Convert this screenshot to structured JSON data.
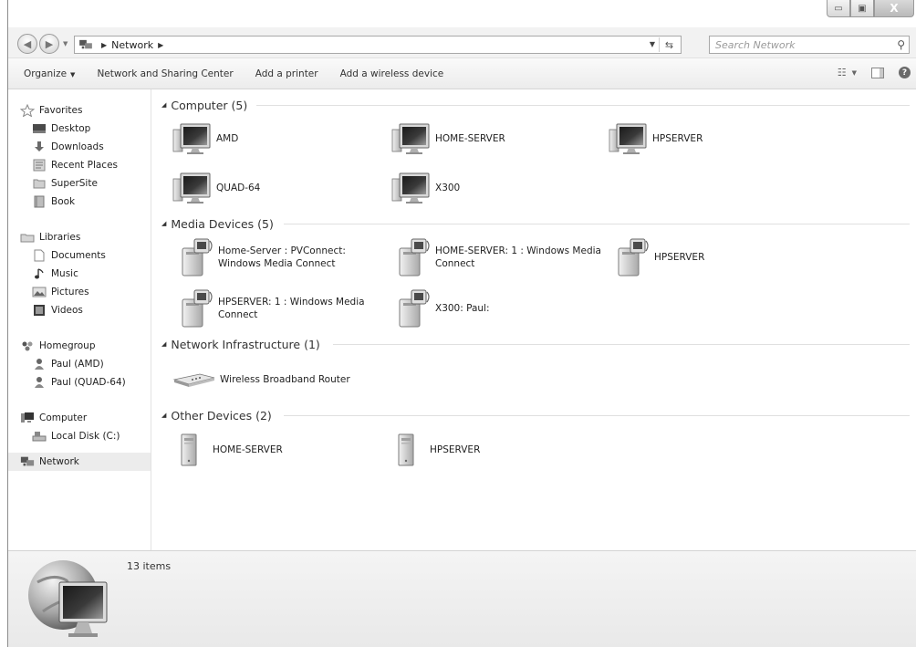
{
  "window": {
    "caption": {
      "minimize": "▭",
      "maximize": "▣",
      "close": "X"
    }
  },
  "address": {
    "crumb": "Network",
    "search_placeholder": "Search Network"
  },
  "toolbar": {
    "organize": "Organize",
    "network_center": "Network and Sharing Center",
    "add_printer": "Add a printer",
    "add_wireless": "Add a wireless device"
  },
  "sidebar": {
    "favorites": {
      "label": "Favorites",
      "items": [
        "Desktop",
        "Downloads",
        "Recent Places",
        "SuperSite",
        "Book"
      ]
    },
    "libraries": {
      "label": "Libraries",
      "items": [
        "Documents",
        "Music",
        "Pictures",
        "Videos"
      ]
    },
    "homegroup": {
      "label": "Homegroup",
      "items": [
        "Paul (AMD)",
        "Paul (QUAD-64)"
      ]
    },
    "computer": {
      "label": "Computer",
      "items": [
        "Local Disk (C:)"
      ]
    },
    "network": {
      "label": "Network"
    }
  },
  "groups": {
    "computer": {
      "header": "Computer (5)",
      "items": [
        "AMD",
        "HOME-SERVER",
        "HPSERVER",
        "QUAD-64",
        "X300"
      ]
    },
    "media": {
      "header": "Media Devices (5)",
      "items": [
        {
          "line1": "Home-Server : PVConnect:",
          "line2": "Windows Media Connect"
        },
        {
          "line1": "HOME-SERVER: 1 : Windows Media",
          "line2": "Connect"
        },
        {
          "line1": "HPSERVER",
          "line2": ""
        },
        {
          "line1": "HPSERVER: 1 : Windows Media",
          "line2": "Connect"
        },
        {
          "line1": "X300: Paul:",
          "line2": ""
        }
      ]
    },
    "infrastructure": {
      "header": "Network Infrastructure (1)",
      "items": [
        "Wireless Broadband Router"
      ]
    },
    "other": {
      "header": "Other Devices (2)",
      "items": [
        "HOME-SERVER",
        "HPSERVER"
      ]
    }
  },
  "status": {
    "count": "13 items"
  },
  "icons": {
    "computer": "monitor-icon",
    "media": "media-device-icon",
    "router": "router-icon",
    "server": "server-icon",
    "network": "network-icon"
  }
}
